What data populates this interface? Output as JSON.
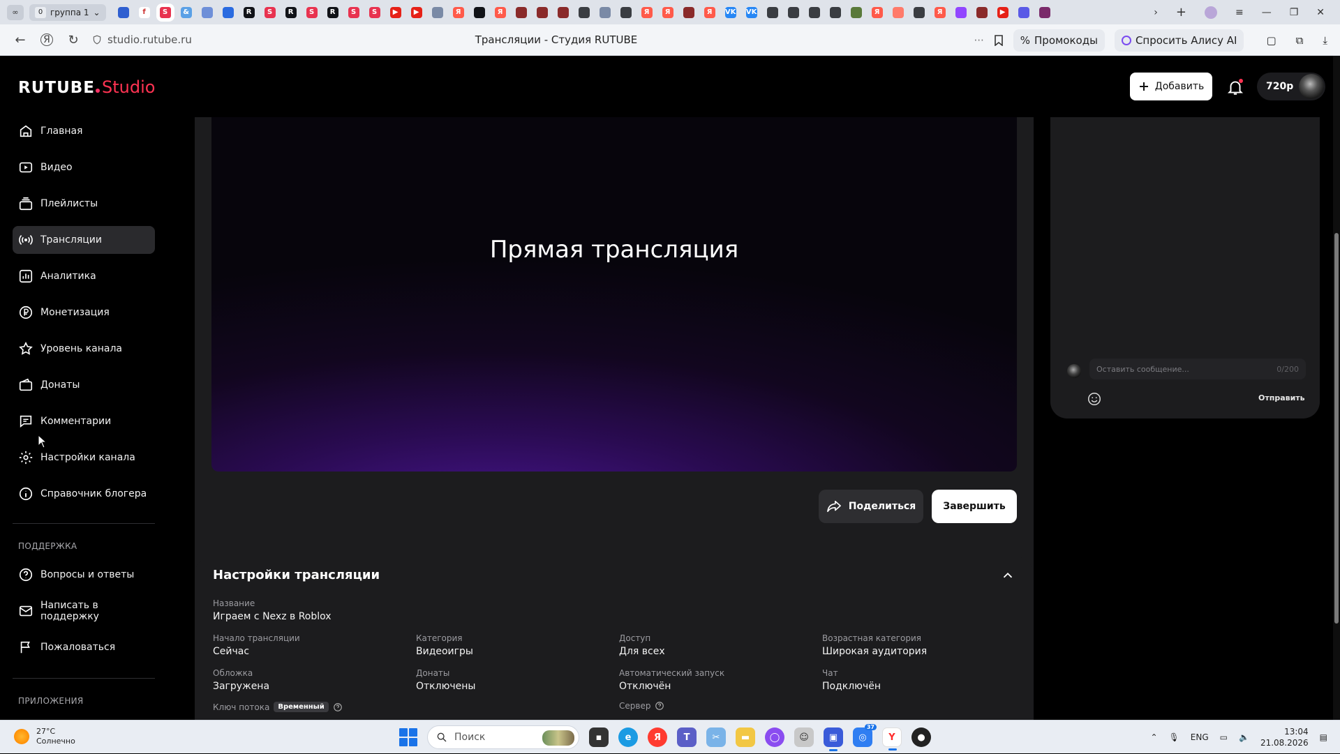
{
  "browser": {
    "tab_group_label": "группа 1",
    "tab_group_count": "0",
    "url": "studio.rutube.ru",
    "page_title": "Трансляции - Студия RUTUBE",
    "promo_label": "Промокоды",
    "alice_label": "Спросить Алису AI",
    "favicons": [
      {
        "letter": "",
        "color": "#2f5fd0"
      },
      {
        "letter": "f",
        "color": "#ffffff"
      },
      {
        "letter": "S",
        "color": "#e8324f"
      },
      {
        "letter": "&",
        "color": "#5aa0e6"
      },
      {
        "letter": "",
        "color": "#6e8fd8"
      },
      {
        "letter": "",
        "color": "#2a6be0"
      },
      {
        "letter": "R",
        "color": "#111318"
      },
      {
        "letter": "S",
        "color": "#e8324f"
      },
      {
        "letter": "R",
        "color": "#111318"
      },
      {
        "letter": "S",
        "color": "#e8324f"
      },
      {
        "letter": "R",
        "color": "#111318"
      },
      {
        "letter": "S",
        "color": "#e8324f"
      },
      {
        "letter": "S",
        "color": "#e8324f"
      },
      {
        "letter": "▶",
        "color": "#e62117"
      },
      {
        "letter": "▶",
        "color": "#e62117"
      },
      {
        "letter": "",
        "color": "#7a8aa6"
      },
      {
        "letter": "Я",
        "color": "#ff5a4a"
      },
      {
        "letter": "",
        "color": "#111318"
      },
      {
        "letter": "Я",
        "color": "#ff5a4a"
      },
      {
        "letter": "",
        "color": "#8a2a2a"
      },
      {
        "letter": "",
        "color": "#8a2a2a"
      },
      {
        "letter": "",
        "color": "#8a2a2a"
      },
      {
        "letter": "",
        "color": "#3a3d42"
      },
      {
        "letter": "",
        "color": "#7a8aa6"
      },
      {
        "letter": "",
        "color": "#3a3d42"
      },
      {
        "letter": "Я",
        "color": "#ff5a4a"
      },
      {
        "letter": "Я",
        "color": "#ff5a4a"
      },
      {
        "letter": "",
        "color": "#8a2a2a"
      },
      {
        "letter": "Я",
        "color": "#ff5a4a"
      },
      {
        "letter": "VK",
        "color": "#2787f5"
      },
      {
        "letter": "VK",
        "color": "#2787f5"
      },
      {
        "letter": "",
        "color": "#3a3d42"
      },
      {
        "letter": "",
        "color": "#3a3d42"
      },
      {
        "letter": "",
        "color": "#3a3d42"
      },
      {
        "letter": "",
        "color": "#3a3d42"
      },
      {
        "letter": "",
        "color": "#5a7a3a"
      },
      {
        "letter": "Я",
        "color": "#ff5a4a"
      },
      {
        "letter": "",
        "color": "#ff7a6a"
      },
      {
        "letter": "",
        "color": "#3a3d42"
      },
      {
        "letter": "Я",
        "color": "#ff5a4a"
      },
      {
        "letter": "",
        "color": "#9146ff"
      },
      {
        "letter": "",
        "color": "#8a2a2a"
      },
      {
        "letter": "▶",
        "color": "#e62117"
      },
      {
        "letter": "",
        "color": "#5a5ae6"
      },
      {
        "letter": "",
        "color": "#7a2a6a"
      }
    ]
  },
  "header": {
    "logo_rutube": "RUTUBE",
    "logo_studio": "Studio",
    "add_label": "Добавить",
    "quality": "720р"
  },
  "sidebar": {
    "items": [
      {
        "label": "Главная",
        "icon": "home-icon"
      },
      {
        "label": "Видео",
        "icon": "video-icon"
      },
      {
        "label": "Плейлисты",
        "icon": "playlist-icon"
      },
      {
        "label": "Трансляции",
        "icon": "broadcast-icon"
      },
      {
        "label": "Аналитика",
        "icon": "analytics-icon"
      },
      {
        "label": "Монетизация",
        "icon": "ruble-icon"
      },
      {
        "label": "Уровень канала",
        "icon": "star-icon"
      },
      {
        "label": "Донаты",
        "icon": "wallet-icon"
      },
      {
        "label": "Комментарии",
        "icon": "comment-icon"
      },
      {
        "label": "Настройки канала",
        "icon": "gear-icon"
      },
      {
        "label": "Справочник блогера",
        "icon": "info-icon"
      }
    ],
    "support_title": "ПОДДЕРЖКА",
    "support_items": [
      {
        "label": "Вопросы и ответы",
        "icon": "question-icon"
      },
      {
        "label": "Написать в поддержку",
        "icon": "mail-icon"
      },
      {
        "label": "Пожаловаться",
        "icon": "flag-icon"
      }
    ],
    "apps_title": "ПРИЛОЖЕНИЯ"
  },
  "player": {
    "title": "Прямая трансляция",
    "share_label": "Поделиться",
    "finish_label": "Завершить"
  },
  "chat": {
    "placeholder": "Оставить сообщение...",
    "counter": "0/200",
    "send_label": "Отправить"
  },
  "settings": {
    "title": "Настройки трансляции",
    "name_label": "Название",
    "name_value": "Играем с Nexz в Roblox",
    "start_label": "Начало трансляции",
    "start_value": "Сейчас",
    "category_label": "Категория",
    "category_value": "Видеоигры",
    "access_label": "Доступ",
    "access_value": "Для всех",
    "age_label": "Возрастная категория",
    "age_value": "Широкая аудитория",
    "cover_label": "Обложка",
    "cover_value": "Загружена",
    "donations_label": "Донаты",
    "donations_value": "Отключены",
    "autostart_label": "Автоматический запуск",
    "autostart_value": "Отключён",
    "chat_label": "Чат",
    "chat_value": "Подключён",
    "stream_key_label": "Ключ потока",
    "stream_key_badge": "Временный",
    "server_label": "Сервер"
  },
  "taskbar": {
    "temperature": "27°C",
    "weather": "Солнечно",
    "search_placeholder": "Поиск",
    "lang": "ENG",
    "time": "13:04",
    "date": "21.08.2026",
    "notification_count": "37"
  },
  "colors": {
    "accent": "#ff3352",
    "app_bg": "#000000",
    "card_bg": "#1c1c1e",
    "active_nav_bg": "#2a2a2d"
  }
}
